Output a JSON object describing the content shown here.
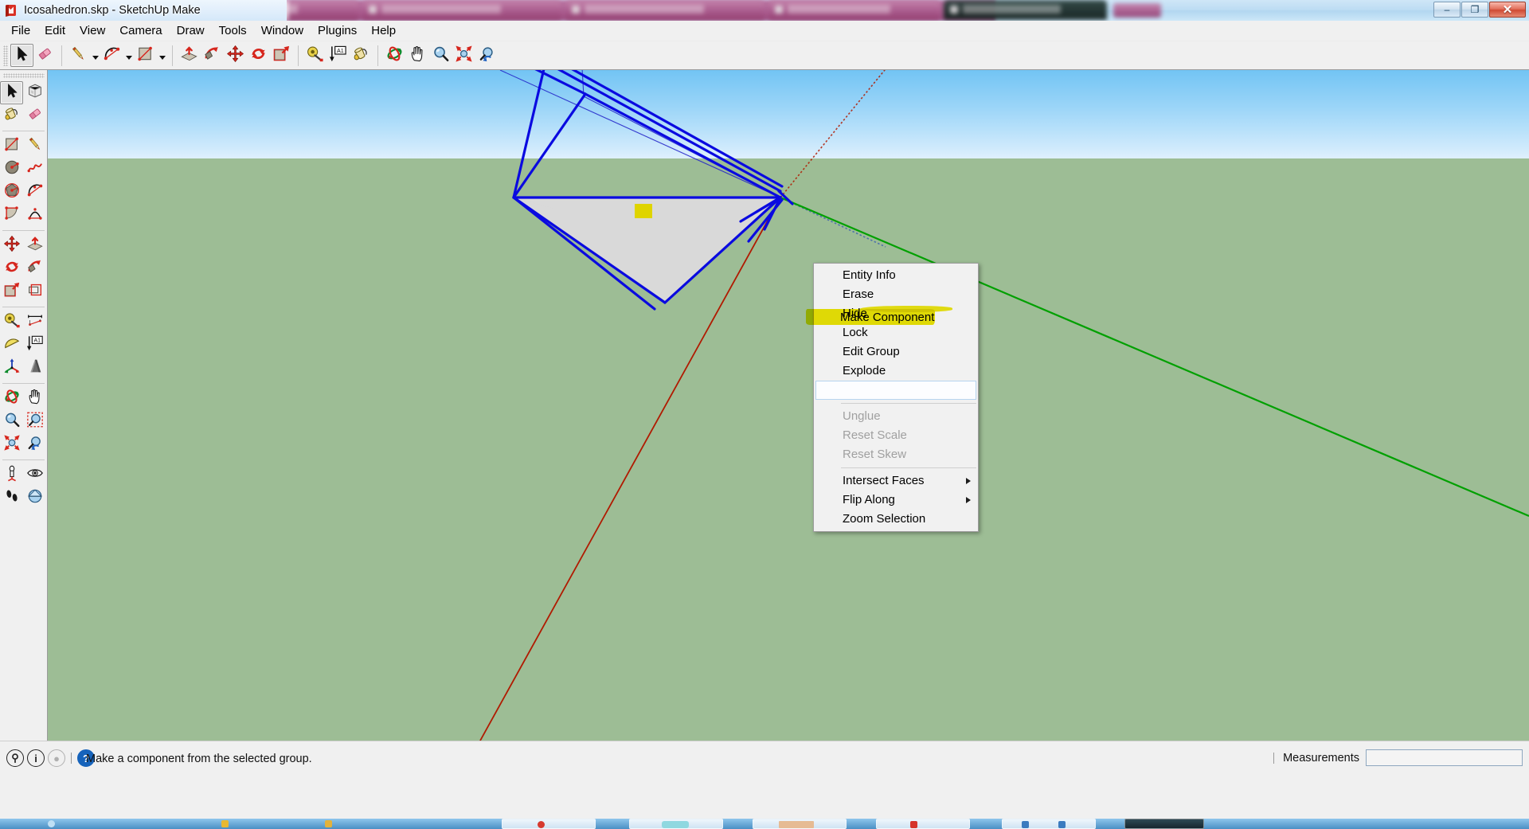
{
  "window": {
    "title": "Icosahedron.skp - SketchUp Make",
    "app_icon": "sketchup-logo-icon",
    "controls": {
      "minimize": "–",
      "restore": "❐",
      "close": "✕"
    }
  },
  "menubar": {
    "items": [
      {
        "label": "File"
      },
      {
        "label": "Edit"
      },
      {
        "label": "View"
      },
      {
        "label": "Camera"
      },
      {
        "label": "Draw"
      },
      {
        "label": "Tools"
      },
      {
        "label": "Window"
      },
      {
        "label": "Plugins"
      },
      {
        "label": "Help"
      }
    ]
  },
  "toolbar": {
    "items": [
      {
        "name": "select-tool",
        "icon": "arrow-cursor-icon",
        "active": true,
        "caret": false
      },
      {
        "name": "eraser-tool",
        "icon": "eraser-icon",
        "active": false,
        "caret": false
      },
      {
        "name": "line-tool",
        "icon": "pencil-icon",
        "active": false,
        "caret": true
      },
      {
        "name": "arc-tool",
        "icon": "arc-icon",
        "active": false,
        "caret": true
      },
      {
        "name": "rectangle-tool",
        "icon": "rectangle-icon",
        "active": false,
        "caret": true
      },
      {
        "name": "pushpull-tool",
        "icon": "push-pull-icon",
        "active": false,
        "caret": false
      },
      {
        "name": "followme-tool",
        "icon": "follow-me-icon",
        "active": false,
        "caret": false
      },
      {
        "name": "move-tool",
        "icon": "move-arrows-icon",
        "active": false,
        "caret": false
      },
      {
        "name": "rotate-tool",
        "icon": "rotate-icon",
        "active": false,
        "caret": false
      },
      {
        "name": "scale-tool",
        "icon": "scale-icon",
        "active": false,
        "caret": false
      },
      {
        "name": "tape-measure-tool",
        "icon": "tape-measure-icon",
        "active": false,
        "caret": false
      },
      {
        "name": "text-tool",
        "icon": "text-label-icon",
        "active": false,
        "caret": false
      },
      {
        "name": "paint-bucket-tool",
        "icon": "paint-bucket-icon",
        "active": false,
        "caret": false
      },
      {
        "name": "orbit-tool",
        "icon": "orbit-icon",
        "active": false,
        "caret": false
      },
      {
        "name": "pan-tool",
        "icon": "hand-pan-icon",
        "active": false,
        "caret": false
      },
      {
        "name": "zoom-tool",
        "icon": "magnifier-icon",
        "active": false,
        "caret": false
      },
      {
        "name": "zoom-extents-tool",
        "icon": "zoom-extents-icon",
        "active": false,
        "caret": false
      },
      {
        "name": "previous-view",
        "icon": "previous-view-icon",
        "active": false,
        "caret": false
      }
    ]
  },
  "left_toolbar": {
    "rows": [
      {
        "sep_after": false,
        "cells": [
          {
            "name": "select-tool",
            "icon": "arrow-cursor-icon",
            "active": true
          },
          {
            "name": "make-component-tool",
            "icon": "component-box-icon",
            "active": false
          }
        ]
      },
      {
        "sep_after": true,
        "cells": [
          {
            "name": "paint-bucket-tool",
            "icon": "paint-bucket-icon",
            "active": false
          },
          {
            "name": "eraser-tool",
            "icon": "eraser-icon",
            "active": false
          }
        ]
      },
      {
        "sep_after": false,
        "cells": [
          {
            "name": "rectangle-tool",
            "icon": "rectangle-icon",
            "active": false
          },
          {
            "name": "line-tool",
            "icon": "pencil-icon",
            "active": false
          }
        ]
      },
      {
        "sep_after": false,
        "cells": [
          {
            "name": "circle-tool",
            "icon": "circle-icon",
            "active": false
          },
          {
            "name": "freehand-tool",
            "icon": "freehand-icon",
            "active": false
          }
        ]
      },
      {
        "sep_after": false,
        "cells": [
          {
            "name": "polygon-tool",
            "icon": "polygon-icon",
            "active": false
          },
          {
            "name": "arc-tool",
            "icon": "arc-icon",
            "active": false
          }
        ]
      },
      {
        "sep_after": true,
        "cells": [
          {
            "name": "pie-tool",
            "icon": "pie-arc-icon",
            "active": false
          },
          {
            "name": "two-point-arc-tool",
            "icon": "two-point-arc-icon",
            "active": false
          }
        ]
      },
      {
        "sep_after": false,
        "cells": [
          {
            "name": "move-tool",
            "icon": "move-arrows-icon",
            "active": false
          },
          {
            "name": "pushpull-tool",
            "icon": "push-pull-icon",
            "active": false
          }
        ]
      },
      {
        "sep_after": false,
        "cells": [
          {
            "name": "rotate-tool",
            "icon": "rotate-icon",
            "active": false
          },
          {
            "name": "followme-tool",
            "icon": "follow-me-icon",
            "active": false
          }
        ]
      },
      {
        "sep_after": true,
        "cells": [
          {
            "name": "scale-tool",
            "icon": "scale-icon",
            "active": false
          },
          {
            "name": "offset-tool",
            "icon": "offset-icon",
            "active": false
          }
        ]
      },
      {
        "sep_after": false,
        "cells": [
          {
            "name": "tape-measure-tool",
            "icon": "tape-measure-icon",
            "active": false
          },
          {
            "name": "dimension-tool",
            "icon": "dimension-icon",
            "active": false
          }
        ]
      },
      {
        "sep_after": false,
        "cells": [
          {
            "name": "protractor-tool",
            "icon": "protractor-icon",
            "active": false
          },
          {
            "name": "text-tool",
            "icon": "text-label-icon",
            "active": false
          }
        ]
      },
      {
        "sep_after": true,
        "cells": [
          {
            "name": "axes-tool",
            "icon": "axes-icon",
            "active": false
          },
          {
            "name": "3d-text-tool",
            "icon": "three-d-text-icon",
            "active": false
          }
        ]
      },
      {
        "sep_after": false,
        "cells": [
          {
            "name": "orbit-tool",
            "icon": "orbit-icon",
            "active": false
          },
          {
            "name": "pan-tool",
            "icon": "hand-pan-icon",
            "active": false
          }
        ]
      },
      {
        "sep_after": false,
        "cells": [
          {
            "name": "zoom-tool",
            "icon": "magnifier-icon",
            "active": false
          },
          {
            "name": "zoom-window-tool",
            "icon": "zoom-window-icon",
            "active": false
          }
        ]
      },
      {
        "sep_after": true,
        "cells": [
          {
            "name": "zoom-extents-tool",
            "icon": "zoom-extents-icon",
            "active": false
          },
          {
            "name": "previous-view-tool",
            "icon": "previous-view-icon",
            "active": false
          }
        ]
      },
      {
        "sep_after": false,
        "cells": [
          {
            "name": "position-camera-tool",
            "icon": "position-camera-icon",
            "active": false
          },
          {
            "name": "look-around-tool",
            "icon": "eye-look-around-icon",
            "active": false
          }
        ]
      },
      {
        "sep_after": false,
        "cells": [
          {
            "name": "walk-tool",
            "icon": "walk-footprints-icon",
            "active": false
          },
          {
            "name": "section-plane-tool",
            "icon": "section-plane-icon",
            "active": false
          }
        ]
      }
    ]
  },
  "context_menu": {
    "highlighted_item": "Make Component",
    "highlight_color": "#ece606",
    "groups": [
      {
        "items": [
          {
            "label": "Entity Info",
            "disabled": false,
            "submenu": false,
            "selected": false
          },
          {
            "label": "Erase",
            "disabled": false,
            "submenu": false,
            "selected": false
          },
          {
            "label": "Hide",
            "disabled": false,
            "submenu": false,
            "selected": false
          },
          {
            "label": "Lock",
            "disabled": false,
            "submenu": false,
            "selected": false
          },
          {
            "label": "Edit Group",
            "disabled": false,
            "submenu": false,
            "selected": false
          },
          {
            "label": "Explode",
            "disabled": false,
            "submenu": false,
            "selected": false
          },
          {
            "label": "Make Component",
            "disabled": false,
            "submenu": false,
            "selected": true
          }
        ]
      },
      {
        "items": [
          {
            "label": "Unglue",
            "disabled": true,
            "submenu": false,
            "selected": false
          },
          {
            "label": "Reset Scale",
            "disabled": true,
            "submenu": false,
            "selected": false
          },
          {
            "label": "Reset Skew",
            "disabled": true,
            "submenu": false,
            "selected": false
          }
        ]
      },
      {
        "items": [
          {
            "label": "Intersect Faces",
            "disabled": false,
            "submenu": true,
            "selected": false
          },
          {
            "label": "Flip Along",
            "disabled": false,
            "submenu": true,
            "selected": false
          },
          {
            "label": "Zoom Selection",
            "disabled": false,
            "submenu": false,
            "selected": false
          }
        ]
      }
    ]
  },
  "viewport": {
    "sky_color_top": "#72c4f4",
    "sky_color_bottom": "#dff0fd",
    "ground_color": "#9dbd95",
    "selection_color": "#0a0ae0",
    "face_color": "#d9d9d9",
    "marker_square_color": "#dfd400",
    "axis_green": "#00a000",
    "axis_red": "#b01a00",
    "model_name": "Icosahedron"
  },
  "statusbar": {
    "message": "Make a component from the selected group.",
    "icons": [
      {
        "name": "geo-location-icon",
        "glyph": "⚲",
        "style": "dark"
      },
      {
        "name": "info-icon",
        "glyph": "i",
        "style": "dark"
      },
      {
        "name": "user-account-icon",
        "glyph": "●",
        "style": "grey"
      },
      {
        "name": "help-icon",
        "glyph": "?",
        "style": "help"
      }
    ],
    "measurements_label": "Measurements",
    "measurements_value": "",
    "measurements_placeholder": ""
  }
}
